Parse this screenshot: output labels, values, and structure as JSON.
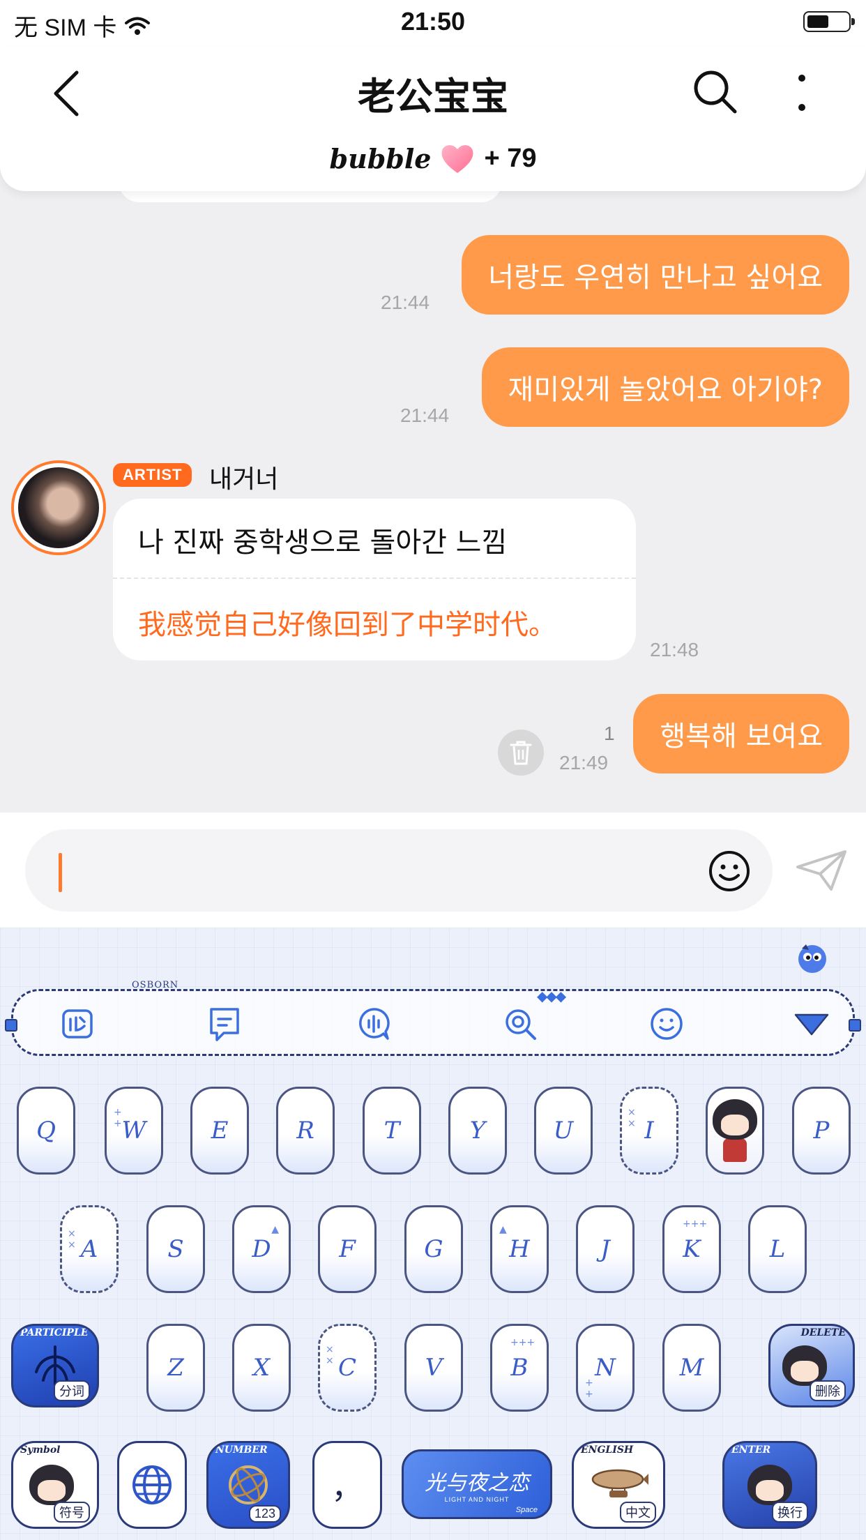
{
  "status_bar": {
    "carrier": "无 SIM 卡",
    "time": "21:50"
  },
  "header": {
    "title": "老公宝宝",
    "bubble_logo": "bubble",
    "bubble_count": "+ 79"
  },
  "chat": {
    "messages": [
      {
        "text": "너랑도 우연히 만나고 싶어요",
        "time": "21:44"
      },
      {
        "text": "재미있게 놀았어요 아기야?",
        "time": "21:44"
      },
      {
        "text": "행복해 보여요",
        "time": "21:49",
        "unread_count": "1"
      }
    ],
    "artist_message": {
      "badge": "ARTIST",
      "sender": "내거너",
      "text_ko": "나 진짜 중학생으로 돌아간 느낌",
      "text_zh": "我感觉自己好像回到了中学时代。",
      "time": "21:48"
    }
  },
  "keyboard": {
    "toolbar_label": "OSBORN",
    "row1": [
      "Q",
      "W",
      "E",
      "R",
      "T",
      "Y",
      "U",
      "I",
      "",
      "P"
    ],
    "row2": [
      "A",
      "S",
      "D",
      "F",
      "G",
      "H",
      "J",
      "K",
      "L"
    ],
    "row3": [
      "Z",
      "X",
      "C",
      "V",
      "B",
      "N",
      "M"
    ],
    "participle": {
      "tag": "PARTICIPLE",
      "label": "分词"
    },
    "delete": {
      "tag": "DELETE",
      "label": "删除"
    },
    "symbol": {
      "tag": "Symbol",
      "label": "符号"
    },
    "number": {
      "tag": "NUMBER",
      "label": "123"
    },
    "punct": "，",
    "space": {
      "brand": "光与夜之恋",
      "sub": "LIGHT AND NIGHT",
      "label": "Space"
    },
    "english": {
      "tag": "ENGLISH",
      "label": "中文"
    },
    "enter": {
      "tag": "ENTER",
      "label": "换行"
    }
  },
  "colors": {
    "accent": "#ff9a4a",
    "accent_strong": "#ff6a1f",
    "keyboard_ink": "#2b3a78"
  }
}
